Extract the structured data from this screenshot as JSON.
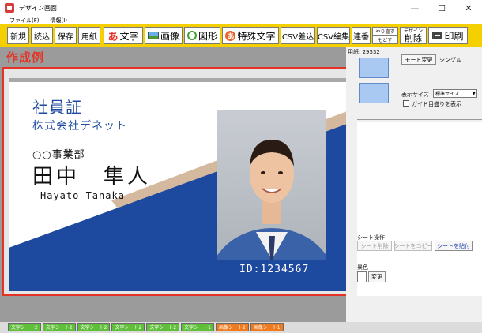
{
  "window": {
    "title": "デザイン画面",
    "controls": [
      "—",
      "☐",
      "✕"
    ]
  },
  "menu": {
    "items": [
      "ファイル(F)",
      "情報(I)"
    ]
  },
  "toolbar": {
    "new": "新規",
    "load": "読込",
    "save": "保存",
    "paper": "用紙",
    "text": "文字",
    "text_icon": "あ",
    "image": "画像",
    "shape": "図形",
    "special_text": "特殊文字",
    "special_icon": "あ",
    "csv_insert": "CSV差込",
    "csv_edit": "CSV編集",
    "serial": "連番",
    "redo": "やり直す",
    "undo": "もどす",
    "design_small": "デザイン",
    "delete": "削除",
    "print": "印刷"
  },
  "example_label": "作成例",
  "card": {
    "title": "社員証",
    "company": "株式会社デネット",
    "department": "○○事業部",
    "name": "田中　隼人",
    "romaji": "Hayato Tanaka",
    "id": "ID:1234567",
    "colors": {
      "primary": "#1d4a9e",
      "gold": "#c7a27e",
      "grey": "#a8a8a8"
    }
  },
  "right_panel": {
    "paper_label": "用紙: 29532",
    "mode_button": "モード変更",
    "mode_value": "シングル",
    "display_size_label": "表示サイズ",
    "display_size_value": "標準サイズ",
    "guide_label": "ガイド目盛りを表示",
    "sheet_ops_label": "シート操作",
    "sheet_delete": "シート削除",
    "sheet_copy": "シートをコピー",
    "sheet_paste": "シートを貼付",
    "bg_color_label": "景色",
    "change_button": "変更"
  },
  "sheet_tabs": [
    {
      "label": "文字シート2",
      "color": "green"
    },
    {
      "label": "文字シート2",
      "color": "green"
    },
    {
      "label": "文字シート2",
      "color": "green"
    },
    {
      "label": "文字シート2",
      "color": "green"
    },
    {
      "label": "文字シート2",
      "color": "green"
    },
    {
      "label": "文字シート1",
      "color": "green"
    },
    {
      "label": "画像シート2",
      "color": "orange"
    },
    {
      "label": "画像シート1",
      "color": "orange"
    }
  ]
}
